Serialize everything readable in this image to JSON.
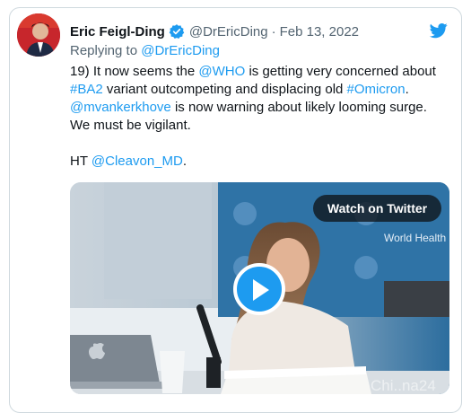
{
  "tweet": {
    "author_name": "Eric Feigl-Ding",
    "author_handle": "@DrEricDing",
    "separator": "·",
    "date": "Feb 13, 2022",
    "replying_label": "Replying to",
    "replying_handle": "@DrEricDing",
    "body": {
      "t1": "19) It now seems the ",
      "m1": "@WHO",
      "t2": " is getting very concerned about ",
      "h1": "#BA2",
      "t3": " variant outcompeting and displacing old ",
      "h2": "#Omicron",
      "t4": ".",
      "m2": "@mvankerkhove",
      "t5": " is now warning about likely looming surge. We must be vigilant.",
      "ht_label": "HT ",
      "m3": "@Cleavon_MD",
      "t6": "."
    }
  },
  "media": {
    "watch_label": "Watch on Twitter",
    "backdrop_text": "World Health Organization",
    "watermark": "Chi..na24"
  },
  "icons": {
    "verified": "verified-badge-icon",
    "brand": "twitter-bird-icon",
    "play": "play-icon",
    "laptop": "apple-logo-icon"
  },
  "colors": {
    "link": "#1d9bf0",
    "text": "#0f1419",
    "muted": "#536471",
    "border": "#cfd9de",
    "play_button": "#1d9bf0"
  }
}
